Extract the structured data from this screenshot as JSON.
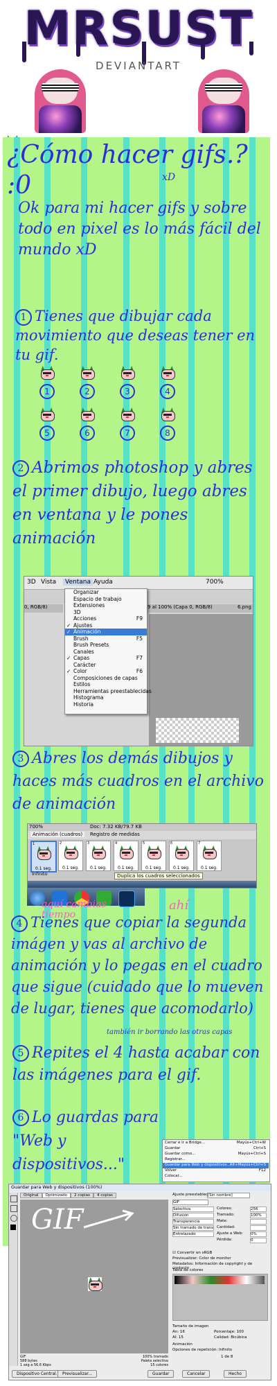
{
  "header": {
    "title": "MRSUST",
    "subtitle": "DEVIANTART"
  },
  "tutorial": {
    "heading": "¿Cómo hacer gifs.? :0",
    "heading_aside": "xD",
    "intro": "Ok para mi hacer gifs y sobre todo en pixel es lo más fácil del mundo xD",
    "step1": {
      "number": "1",
      "text": "Tienes que dibujar cada movimiento que deseas tener en tu gif."
    },
    "frame_numbers": [
      "1",
      "2",
      "3",
      "4",
      "5",
      "6",
      "7",
      "8"
    ],
    "step2": {
      "number": "2",
      "text": "Abrimos photoshop y abres el primer dibujo, luego abres en ventana y le pones animación"
    },
    "step3": {
      "number": "3",
      "text": "Abres los demás dibujos y haces más cuadros en el archivo de animación"
    },
    "step4": {
      "number": "4",
      "text": "Tienes que copiar la segunda imágen y vas al archivo de animación y lo pegas en el cuadro que sigue (cuidado que lo mueven de lugar, tienes que acomodarlo)",
      "aside": "también ir borrando las otras capas"
    },
    "step5": {
      "number": "5",
      "text": "Repites el 4 hasta acabar con las imágenes para el gif."
    },
    "step6": {
      "number": "6",
      "text": "Lo guardas para \"Web y dispositivos...\""
    }
  },
  "ps_window_menu": {
    "menubar": [
      "3D",
      "Vista",
      "Ventana",
      "Ayuda"
    ],
    "zoom": "700%",
    "doc_tab_left": "0, RGB/8)",
    "doc_tab_right": "9 al 100% (Capa 0, RGB/8)",
    "doc_tab_file": "6.png",
    "items": [
      {
        "label": "Organizar",
        "key": "",
        "checked": false,
        "selected": false
      },
      {
        "label": "Espacio de trabajo",
        "key": "",
        "checked": false,
        "selected": false
      },
      {
        "label": "Extensiones",
        "key": "",
        "checked": false,
        "selected": false
      },
      {
        "label": "3D",
        "key": "",
        "checked": false,
        "selected": false
      },
      {
        "label": "Acciones",
        "key": "F9",
        "checked": false,
        "selected": false
      },
      {
        "label": "Ajustes",
        "key": "",
        "checked": true,
        "selected": false
      },
      {
        "label": "Animación",
        "key": "",
        "checked": true,
        "selected": true
      },
      {
        "label": "Brush",
        "key": "F5",
        "checked": false,
        "selected": false
      },
      {
        "label": "Brush Presets",
        "key": "",
        "checked": false,
        "selected": false
      },
      {
        "label": "Canales",
        "key": "",
        "checked": false,
        "selected": false
      },
      {
        "label": "Capas",
        "key": "F7",
        "checked": true,
        "selected": false
      },
      {
        "label": "Carácter",
        "key": "",
        "checked": false,
        "selected": false
      },
      {
        "label": "Color",
        "key": "F6",
        "checked": true,
        "selected": false
      },
      {
        "label": "Composiciones de capas",
        "key": "",
        "checked": false,
        "selected": false
      },
      {
        "label": "Estilos",
        "key": "",
        "checked": false,
        "selected": false
      },
      {
        "label": "Herramientas preestablecidas",
        "key": "",
        "checked": false,
        "selected": false
      },
      {
        "label": "Histograma",
        "key": "",
        "checked": false,
        "selected": false
      },
      {
        "label": "Historia",
        "key": "",
        "checked": false,
        "selected": false
      }
    ]
  },
  "ps_animation_panel": {
    "zoom": "700%",
    "doc_info": "Doc: 7.32 KB/79.7 KB",
    "tab_active": "Animación (cuadros)",
    "tab_other": "Registro de medidas",
    "frames": [
      {
        "num": "1",
        "delay": "0.1 seg."
      },
      {
        "num": "2",
        "delay": "0.1 seg."
      },
      {
        "num": "3",
        "delay": "0.1 seg."
      },
      {
        "num": "4",
        "delay": "0.1 seg."
      },
      {
        "num": "5",
        "delay": "0.1 seg."
      },
      {
        "num": "6",
        "delay": "0.1 seg."
      },
      {
        "num": "7",
        "delay": "0.1 seg."
      }
    ],
    "loop": "Infinito",
    "tooltip": "Duplica los cuadros seleccionados",
    "note_here_button": "aquí cambias tiempo",
    "note_there": "ahí"
  },
  "ps_file_menu": {
    "items": [
      {
        "label": "Cerrar e ir a Bridge...",
        "key": "Mayús+Ctrl+W"
      },
      {
        "label": "Guardar",
        "key": "Ctrl+S"
      },
      {
        "label": "Guardar como...",
        "key": "Mayús+Ctrl+S"
      },
      {
        "label": "Registrar...",
        "key": ""
      },
      {
        "label": "Guardar para Web y dispositivos...",
        "key": "Alt+Mayús+Ctrl+S"
      },
      {
        "label": "Volver",
        "key": "F12"
      },
      {
        "label": "Colocar...",
        "key": ""
      }
    ]
  },
  "save_web_dialog": {
    "title": "Guardar para Web y dispositivos (100%)",
    "tabs": [
      "Original",
      "Optimizado",
      "2 copias",
      "4 copias"
    ],
    "overlay_text": "GIF",
    "preset_label": "Ajuste preestablecido:",
    "preset_value": "[Sin nombre]",
    "format": "GIF",
    "options_left": [
      "Selectiva",
      "Difusión",
      "Transparencia",
      "Sin tramado de transp...",
      "Entrelazado"
    ],
    "options_right": [
      "Colores:",
      "Tramado:",
      "Mate:",
      "Cantidad:",
      "Ajuste a Web:",
      "Pérdida:"
    ],
    "option_values": [
      "256",
      "100%",
      "",
      "",
      "0%",
      "0"
    ],
    "convert_srgb": "Convertir en sRGB",
    "preview_label": "Previsualizar:",
    "preview_value": "Color de monitor",
    "metadata_label": "Metadatos:",
    "metadata_value": "Información de copyright y de contacto",
    "color_table": "Tabla de colores",
    "image_size": "Tamaño de imagen",
    "w_label": "An:",
    "w_value": "16",
    "h_label": "Al:",
    "h_value": "15",
    "percent_label": "Porcentaje:",
    "percent_value": "100",
    "quality_label": "Calidad:",
    "quality_value": "Bicúbica",
    "animation_label": "Animación",
    "loop_label": "Opciones de repetición:",
    "loop_value": "Infinito",
    "frame_counter": "1 de 8",
    "status_left": "GIF\n588 bytes\n1 seg a 56,6 Kbps",
    "status_right": "100% tramado\nPaleta selectiva\n15 colores",
    "buttons": [
      "Dispositivo Central...",
      "Previsualizar...",
      "Guardar",
      "Cancelar",
      "Hecho"
    ],
    "zoom": "100%"
  },
  "colors": {
    "background": "#b4f58a",
    "stripe": "#49ddd0",
    "ink": "#2b2fd8",
    "pink_note": "#ff5ac6",
    "menu_highlight": "#3a7ad8"
  }
}
